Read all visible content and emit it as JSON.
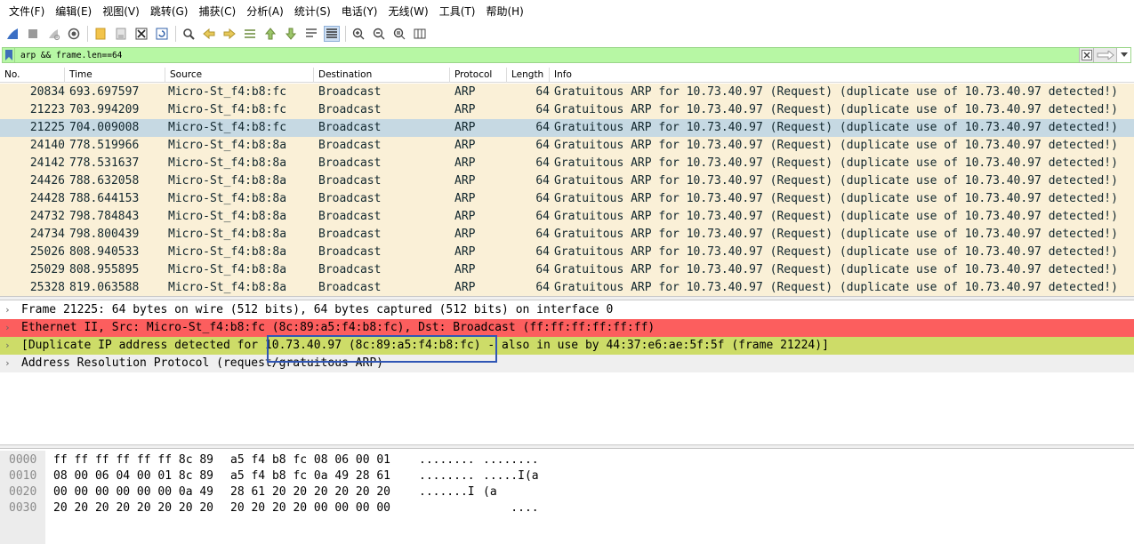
{
  "menu": [
    "文件(F)",
    "编辑(E)",
    "视图(V)",
    "跳转(G)",
    "捕获(C)",
    "分析(A)",
    "统计(S)",
    "电话(Y)",
    "无线(W)",
    "工具(T)",
    "帮助(H)"
  ],
  "toolbar_icons": [
    "shark-fin-start-icon",
    "stop-capture-icon",
    "restart-capture-icon",
    "capture-options-icon",
    "open-file-icon",
    "save-file-icon",
    "close-file-icon",
    "reload-file-icon",
    "find-packet-icon",
    "go-back-icon",
    "go-forward-icon",
    "go-to-packet-icon",
    "go-first-packet-icon",
    "go-last-packet-icon",
    "auto-scroll-icon",
    "colorize-icon",
    "zoom-in-icon",
    "zoom-out-icon",
    "zoom-normal-icon",
    "resize-columns-icon"
  ],
  "filter": {
    "value": "arp && frame.len==64",
    "bg_color": "#b7f7a4"
  },
  "packet_list": {
    "columns": [
      "No.",
      "Time",
      "Source",
      "Destination",
      "Protocol",
      "Length",
      "Info"
    ],
    "selected_index": 2,
    "rows": [
      {
        "no": "20834",
        "time": "693.697597",
        "src": "Micro-St_f4:b8:fc",
        "dst": "Broadcast",
        "proto": "ARP",
        "len": "64",
        "info": "Gratuitous ARP for 10.73.40.97 (Request) (duplicate use of 10.73.40.97 detected!)"
      },
      {
        "no": "21223",
        "time": "703.994209",
        "src": "Micro-St_f4:b8:fc",
        "dst": "Broadcast",
        "proto": "ARP",
        "len": "64",
        "info": "Gratuitous ARP for 10.73.40.97 (Request) (duplicate use of 10.73.40.97 detected!)"
      },
      {
        "no": "21225",
        "time": "704.009008",
        "src": "Micro-St_f4:b8:fc",
        "dst": "Broadcast",
        "proto": "ARP",
        "len": "64",
        "info": "Gratuitous ARP for 10.73.40.97 (Request) (duplicate use of 10.73.40.97 detected!)"
      },
      {
        "no": "24140",
        "time": "778.519966",
        "src": "Micro-St_f4:b8:8a",
        "dst": "Broadcast",
        "proto": "ARP",
        "len": "64",
        "info": "Gratuitous ARP for 10.73.40.97 (Request) (duplicate use of 10.73.40.97 detected!)"
      },
      {
        "no": "24142",
        "time": "778.531637",
        "src": "Micro-St_f4:b8:8a",
        "dst": "Broadcast",
        "proto": "ARP",
        "len": "64",
        "info": "Gratuitous ARP for 10.73.40.97 (Request) (duplicate use of 10.73.40.97 detected!)"
      },
      {
        "no": "24426",
        "time": "788.632058",
        "src": "Micro-St_f4:b8:8a",
        "dst": "Broadcast",
        "proto": "ARP",
        "len": "64",
        "info": "Gratuitous ARP for 10.73.40.97 (Request) (duplicate use of 10.73.40.97 detected!)"
      },
      {
        "no": "24428",
        "time": "788.644153",
        "src": "Micro-St_f4:b8:8a",
        "dst": "Broadcast",
        "proto": "ARP",
        "len": "64",
        "info": "Gratuitous ARP for 10.73.40.97 (Request) (duplicate use of 10.73.40.97 detected!)"
      },
      {
        "no": "24732",
        "time": "798.784843",
        "src": "Micro-St_f4:b8:8a",
        "dst": "Broadcast",
        "proto": "ARP",
        "len": "64",
        "info": "Gratuitous ARP for 10.73.40.97 (Request) (duplicate use of 10.73.40.97 detected!)"
      },
      {
        "no": "24734",
        "time": "798.800439",
        "src": "Micro-St_f4:b8:8a",
        "dst": "Broadcast",
        "proto": "ARP",
        "len": "64",
        "info": "Gratuitous ARP for 10.73.40.97 (Request) (duplicate use of 10.73.40.97 detected!)"
      },
      {
        "no": "25026",
        "time": "808.940533",
        "src": "Micro-St_f4:b8:8a",
        "dst": "Broadcast",
        "proto": "ARP",
        "len": "64",
        "info": "Gratuitous ARP for 10.73.40.97 (Request) (duplicate use of 10.73.40.97 detected!)"
      },
      {
        "no": "25029",
        "time": "808.955895",
        "src": "Micro-St_f4:b8:8a",
        "dst": "Broadcast",
        "proto": "ARP",
        "len": "64",
        "info": "Gratuitous ARP for 10.73.40.97 (Request) (duplicate use of 10.73.40.97 detected!)"
      },
      {
        "no": "25328",
        "time": "819.063588",
        "src": "Micro-St_f4:b8:8a",
        "dst": "Broadcast",
        "proto": "ARP",
        "len": "64",
        "info": "Gratuitous ARP for 10.73.40.97 (Request) (duplicate use of 10.73.40.97 detected!)"
      }
    ],
    "row_color": "#faf0d7",
    "selected_color": "#c6d9e3"
  },
  "details": {
    "frame": "Frame 21225: 64 bytes on wire (512 bits), 64 bytes captured (512 bits) on interface 0",
    "ethernet": "Ethernet II, Src: Micro-St_f4:b8:fc (8c:89:a5:f4:b8:fc), Dst: Broadcast (ff:ff:ff:ff:ff:ff)",
    "duplicate": "[Duplicate IP address detected for 10.73.40.97 (8c:89:a5:f4:b8:fc) - also in use by 44:37:e6:ae:5f:5f (frame 21224)]",
    "arp": "Address Resolution Protocol (request/gratuitous ARP)",
    "error_color": "#fc5e5e",
    "warning_color": "#cddc68"
  },
  "hex": [
    {
      "offset": "0000",
      "bytes1": "ff ff ff ff ff ff 8c 89",
      "bytes2": "a5 f4 b8 fc 08 06 00 01",
      "ascii1": "........",
      "ascii2": "........"
    },
    {
      "offset": "0010",
      "bytes1": "08 00 06 04 00 01 8c 89",
      "bytes2": "a5 f4 b8 fc 0a 49 28 61",
      "ascii1": "........",
      "ascii2": ".....I(a"
    },
    {
      "offset": "0020",
      "bytes1": "00 00 00 00 00 00 0a 49",
      "bytes2": "28 61 20 20 20 20 20 20",
      "ascii1": ".......I",
      "ascii2": "(a"
    },
    {
      "offset": "0030",
      "bytes1": "20 20 20 20 20 20 20 20",
      "bytes2": "20 20 20 20 00 00 00 00",
      "ascii1": "",
      "ascii2": "    ...."
    }
  ]
}
